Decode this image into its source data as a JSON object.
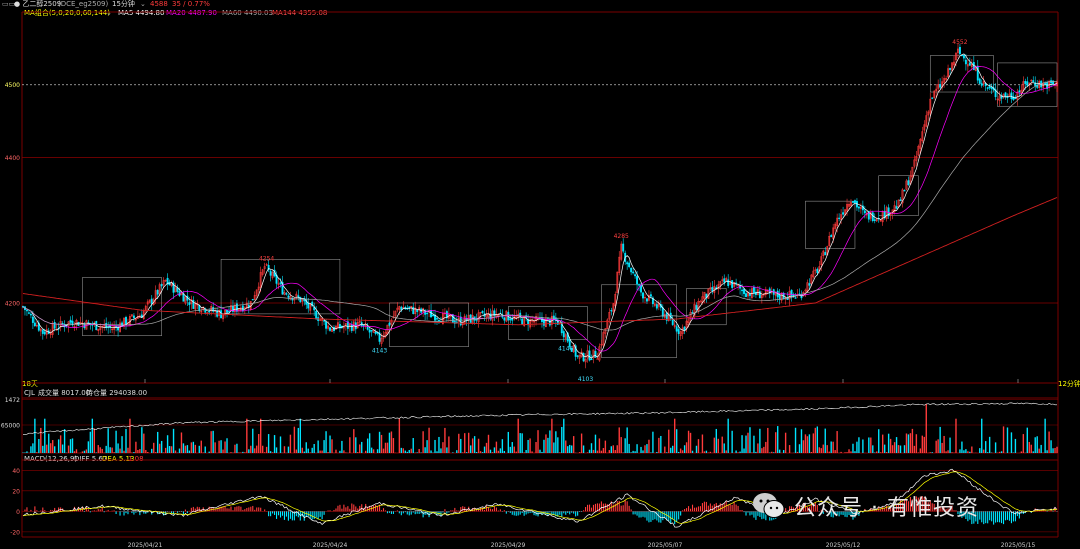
{
  "header": {
    "menu_icon": "menu-icon",
    "instrument": "● 乙二醇2509",
    "exchange": "(DCE_eg2509)",
    "period": "15分钟",
    "last_price": "4588",
    "change": "35 / 0.77%"
  },
  "ma_legend": {
    "label": "MA组合(5,0,20,0,60,144)",
    "ma5": "MA5 4494.80",
    "ma20": "MA20 4487.90",
    "ma60": "MA60 4490.03",
    "ma144": "MA144 4355.08"
  },
  "vol_legend": {
    "label": "CJL",
    "volume": "成交量 8017.00",
    "oi": "持仓量 294038.00"
  },
  "macd_legend": {
    "label": "MACD(12,26,9)",
    "diff": "DIFF 5.67",
    "dea": "DEA 5.13",
    "macd": "1.08"
  },
  "footer": {
    "left_marker": "18天",
    "right_marker": "12分钟前"
  },
  "watermark": {
    "text": "公众号 · 有惟投资",
    "icon": "wechat-icon"
  },
  "colors": {
    "up": "#ff3b3b",
    "down": "#00e5ff",
    "ma5": "#ffffff",
    "ma20": "#ffff00",
    "ma60": "#ff00ff",
    "ma144": "#00ff00",
    "grid": "#8b0000"
  },
  "chart_data": {
    "type": "candlestick",
    "price_axis": {
      "ticks": [
        4200,
        4400,
        4500
      ],
      "range": [
        4090,
        4600
      ],
      "highlight": 4500
    },
    "x_axis": {
      "ticks": [
        "2025/04/21",
        "2025/04/24",
        "2025/04/29",
        "2025/05/07",
        "2025/05/12",
        "2025/05/15"
      ]
    },
    "annotations": [
      {
        "label": "4146",
        "value": 4146,
        "kind": "low"
      },
      {
        "label": "4254",
        "value": 4254,
        "kind": "high"
      },
      {
        "label": "4143",
        "value": 4143,
        "kind": "low"
      },
      {
        "label": "4285",
        "value": 4285,
        "kind": "high"
      },
      {
        "label": "4103",
        "value": 4103,
        "kind": "low"
      },
      {
        "label": "4552",
        "value": 4552,
        "kind": "high"
      }
    ],
    "volume_axis": {
      "ticks": [
        "1472",
        "65000"
      ]
    },
    "macd_axis": {
      "ticks": [
        40,
        20,
        0,
        -20
      ],
      "range": [
        -25,
        50
      ]
    },
    "close_waypoints": [
      [
        0,
        4195
      ],
      [
        10,
        4160
      ],
      [
        25,
        4175
      ],
      [
        45,
        4165
      ],
      [
        60,
        4185
      ],
      [
        72,
        4230
      ],
      [
        85,
        4200
      ],
      [
        100,
        4185
      ],
      [
        115,
        4200
      ],
      [
        122,
        4250
      ],
      [
        132,
        4215
      ],
      [
        140,
        4205
      ],
      [
        155,
        4165
      ],
      [
        170,
        4170
      ],
      [
        180,
        4150
      ],
      [
        190,
        4195
      ],
      [
        205,
        4185
      ],
      [
        220,
        4175
      ],
      [
        240,
        4185
      ],
      [
        255,
        4175
      ],
      [
        270,
        4175
      ],
      [
        280,
        4125
      ],
      [
        290,
        4130
      ],
      [
        298,
        4200
      ],
      [
        302,
        4275
      ],
      [
        312,
        4215
      ],
      [
        322,
        4190
      ],
      [
        332,
        4160
      ],
      [
        342,
        4205
      ],
      [
        355,
        4230
      ],
      [
        365,
        4215
      ],
      [
        380,
        4210
      ],
      [
        392,
        4210
      ],
      [
        402,
        4250
      ],
      [
        410,
        4310
      ],
      [
        418,
        4345
      ],
      [
        425,
        4320
      ],
      [
        433,
        4320
      ],
      [
        442,
        4335
      ],
      [
        450,
        4390
      ],
      [
        458,
        4480
      ],
      [
        466,
        4510
      ],
      [
        472,
        4545
      ],
      [
        478,
        4530
      ],
      [
        485,
        4500
      ],
      [
        492,
        4485
      ],
      [
        500,
        4485
      ],
      [
        508,
        4505
      ],
      [
        515,
        4500
      ],
      [
        522,
        4500
      ]
    ],
    "ma144_waypoints": [
      [
        0,
        4213
      ],
      [
        60,
        4190
      ],
      [
        150,
        4178
      ],
      [
        250,
        4170
      ],
      [
        330,
        4178
      ],
      [
        400,
        4200
      ],
      [
        450,
        4260
      ],
      [
        500,
        4320
      ],
      [
        522,
        4345
      ]
    ],
    "oi_waypoints": [
      [
        0,
        0.35
      ],
      [
        80,
        0.55
      ],
      [
        160,
        0.62
      ],
      [
        260,
        0.7
      ],
      [
        320,
        0.73
      ],
      [
        400,
        0.8
      ],
      [
        450,
        0.88
      ],
      [
        500,
        0.9
      ],
      [
        522,
        0.89
      ]
    ],
    "macd_waypoints": [
      [
        0,
        -3
      ],
      [
        40,
        5
      ],
      [
        80,
        -4
      ],
      [
        120,
        15
      ],
      [
        150,
        -12
      ],
      [
        180,
        8
      ],
      [
        210,
        -4
      ],
      [
        240,
        7
      ],
      [
        280,
        -10
      ],
      [
        305,
        16
      ],
      [
        330,
        -15
      ],
      [
        360,
        14
      ],
      [
        380,
        -5
      ],
      [
        400,
        12
      ],
      [
        420,
        -2
      ],
      [
        440,
        8
      ],
      [
        455,
        35
      ],
      [
        470,
        40
      ],
      [
        485,
        18
      ],
      [
        500,
        -2
      ],
      [
        522,
        3
      ]
    ]
  }
}
